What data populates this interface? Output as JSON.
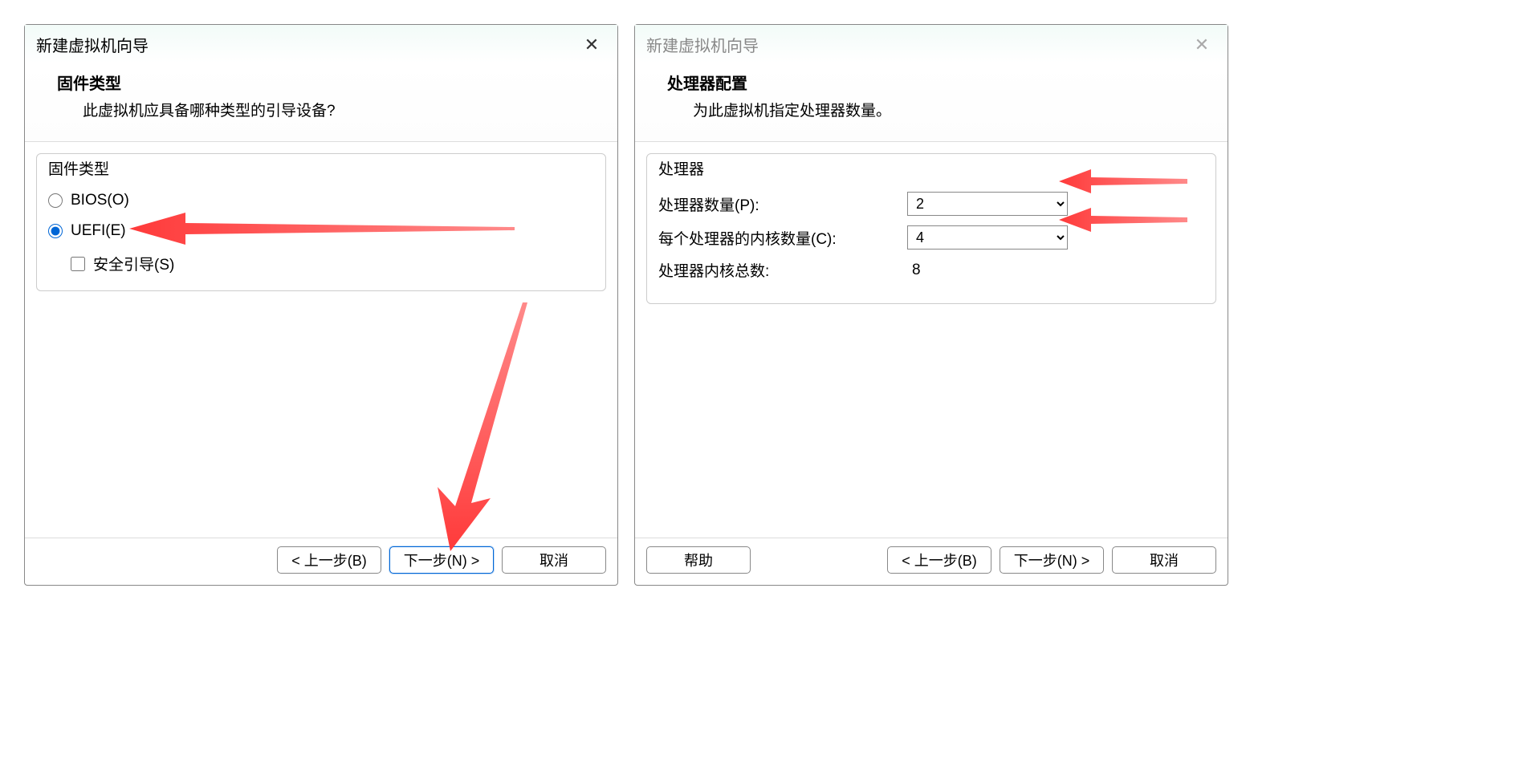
{
  "left": {
    "title": "新建虚拟机向导",
    "heading": "固件类型",
    "subheading": "此虚拟机应具备哪种类型的引导设备?",
    "group_label": "固件类型",
    "bios_label": "BIOS(O)",
    "uefi_label": "UEFI(E)",
    "secure_boot_label": "安全引导(S)",
    "buttons": {
      "back": "< 上一步(B)",
      "next": "下一步(N) >",
      "cancel": "取消"
    }
  },
  "right": {
    "title": "新建虚拟机向导",
    "heading": "处理器配置",
    "subheading": "为此虚拟机指定处理器数量。",
    "group_label": "处理器",
    "proc_count_label": "处理器数量(P):",
    "proc_count_value": "2",
    "cores_per_label": "每个处理器的内核数量(C):",
    "cores_per_value": "4",
    "total_label": "处理器内核总数:",
    "total_value": "8",
    "buttons": {
      "help": "帮助",
      "back": "< 上一步(B)",
      "next": "下一步(N) >",
      "cancel": "取消"
    }
  }
}
